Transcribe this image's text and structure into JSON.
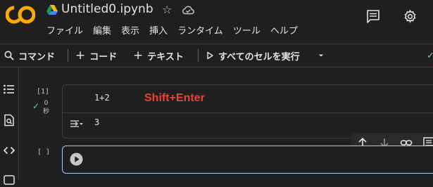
{
  "header": {
    "logo_text": "CO",
    "notebook_title": "Untitled0.ipynb",
    "menu": [
      "ファイル",
      "編集",
      "表示",
      "挿入",
      "ランタイム",
      "ツール",
      "ヘルプ"
    ],
    "icons": [
      "drive-icon",
      "star-icon",
      "cloud-saved-icon",
      "comments-icon",
      "settings-icon"
    ]
  },
  "toolbar": {
    "command_label": "コマンド",
    "add_code_label": "コード",
    "add_text_label": "テキスト",
    "run_all_label": "すべてのセルを実行"
  },
  "cells": [
    {
      "execution_count": "[1]",
      "run_time": "0\n秒",
      "code": "1+2",
      "annotation": "Shift+Enter",
      "output": "3"
    },
    {
      "execution_count": "[ ]",
      "code": ""
    }
  ],
  "colors": {
    "background": "#1f1f1f",
    "logo_orange": "#f9ab00",
    "annotation_red": "#ea4335",
    "active_cell_border": "#a8c7fa",
    "success_green": "#6dd58c"
  }
}
